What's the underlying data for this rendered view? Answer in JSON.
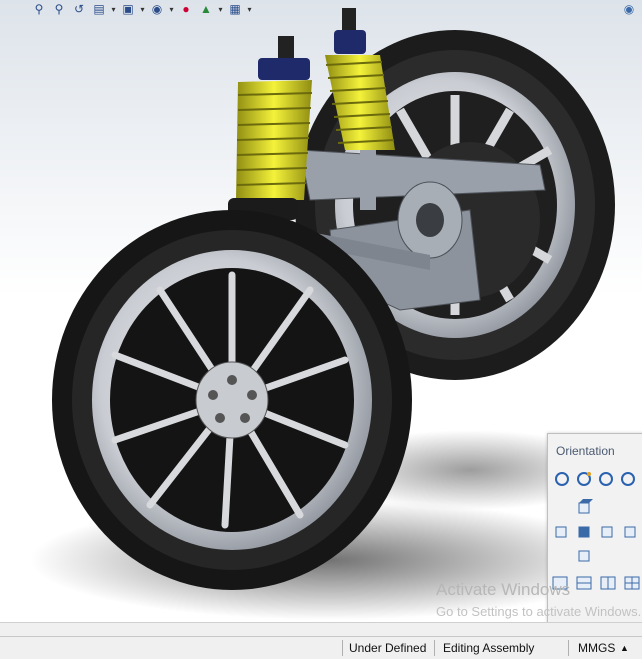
{
  "toolbar": {
    "icons": [
      "zoom-to-fit-icon",
      "zoom-area-icon",
      "previous-view-icon",
      "section-view-icon",
      "view-orientation-icon",
      "display-style-icon",
      "hide-show-icon",
      "edit-appearance-icon",
      "apply-scene-icon",
      "view-settings-icon"
    ],
    "pin_icon": "pushpin-icon"
  },
  "orientation_panel": {
    "title": "Orientation"
  },
  "watermark": {
    "line1": "Activate Windows",
    "line2": "Go to Settings to activate Windows."
  },
  "status_bar": {
    "state": "Under Defined",
    "mode": "Editing Assembly",
    "units": "MMGS",
    "units_caret": "▲"
  },
  "colors": {
    "spring": "#d9d62a",
    "tire": "#1a1a1a",
    "rim": "#c9ccd2",
    "status_bg": "#f0f0f0"
  }
}
